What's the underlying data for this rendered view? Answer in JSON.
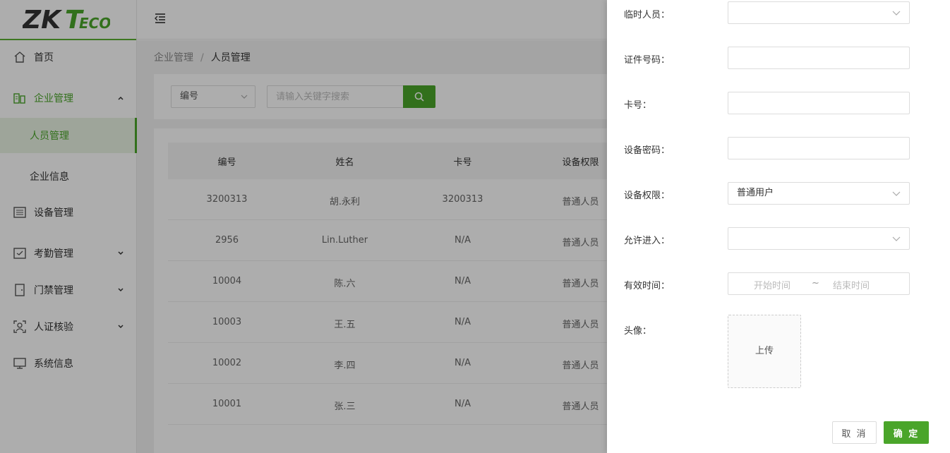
{
  "app": {
    "logo_text": "ZKTeco"
  },
  "sidebar": {
    "items": [
      {
        "label": "首页",
        "icon": "home-icon"
      },
      {
        "label": "企业管理",
        "icon": "building-icon",
        "expanded": true,
        "children": [
          {
            "label": "人员管理",
            "active": true
          },
          {
            "label": "企业信息"
          }
        ]
      },
      {
        "label": "设备管理",
        "icon": "device-list-icon"
      },
      {
        "label": "考勤管理",
        "icon": "attendance-icon"
      },
      {
        "label": "门禁管理",
        "icon": "door-icon"
      },
      {
        "label": "人证核验",
        "icon": "face-scan-icon"
      },
      {
        "label": "系统信息",
        "icon": "monitor-icon"
      }
    ]
  },
  "breadcrumb": {
    "parent": "企业管理",
    "separator": "/",
    "current": "人员管理"
  },
  "search": {
    "field_select": "编号",
    "placeholder": "请输入关键字搜索"
  },
  "table": {
    "columns": [
      "编号",
      "姓名",
      "卡号",
      "设备权限"
    ],
    "rows": [
      [
        "3200313",
        "胡.永利",
        "3200313",
        "普通人员"
      ],
      [
        "2956",
        "Lin.Luther",
        "N/A",
        "普通人员"
      ],
      [
        "10004",
        "陈.六",
        "N/A",
        "普通人员"
      ],
      [
        "10003",
        "王.五",
        "N/A",
        "普通人员"
      ],
      [
        "10002",
        "李.四",
        "N/A",
        "普通人员"
      ],
      [
        "10001",
        "张.三",
        "N/A",
        "普通人员"
      ]
    ]
  },
  "drawer": {
    "temp_person": {
      "label": "临时人员：",
      "value": ""
    },
    "id_number": {
      "label": "证件号码：",
      "value": ""
    },
    "card_no": {
      "label": "卡号：",
      "value": ""
    },
    "device_password": {
      "label": "设备密码：",
      "value": ""
    },
    "device_permission": {
      "label": "设备权限：",
      "value": "普通用户"
    },
    "allow_entry": {
      "label": "允许进入：",
      "value": ""
    },
    "valid_time": {
      "label": "有效时间：",
      "start_placeholder": "开始时间",
      "separator": "~",
      "end_placeholder": "结束时间"
    },
    "avatar": {
      "label": "头像：",
      "upload_label": "上传"
    },
    "cancel_label": "取 消",
    "ok_label": "确 定"
  },
  "colors": {
    "accent": "#4aa52a",
    "overlay": "rgba(0,0,0,0.32)"
  }
}
